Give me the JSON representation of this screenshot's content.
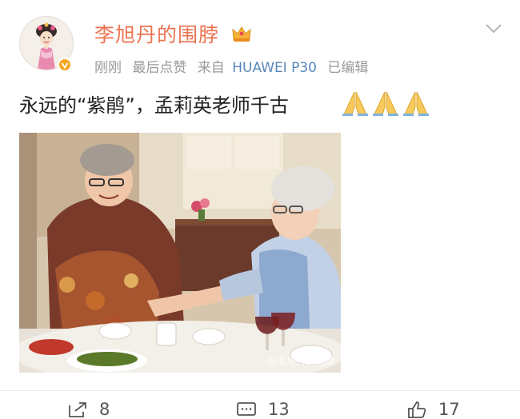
{
  "user": {
    "name": "李旭丹的围脖",
    "avatar_icon": "avatar-opera-figure",
    "verified_icon": "verified-badge-icon",
    "name_color": "#eb7350"
  },
  "meta": {
    "time": "刚刚",
    "last_like": "最后点赞",
    "source_prefix": "来自",
    "source_device": "HUAWEI P30",
    "edited": "已编辑"
  },
  "post": {
    "text": "永远的“紫鹃”，孟莉英老师千古",
    "emoji": "praying-hands-icon",
    "image_watermark": "@李旭丹的围脖"
  },
  "actions": {
    "repost_count": "8",
    "comment_count": "13",
    "like_count": "17"
  }
}
